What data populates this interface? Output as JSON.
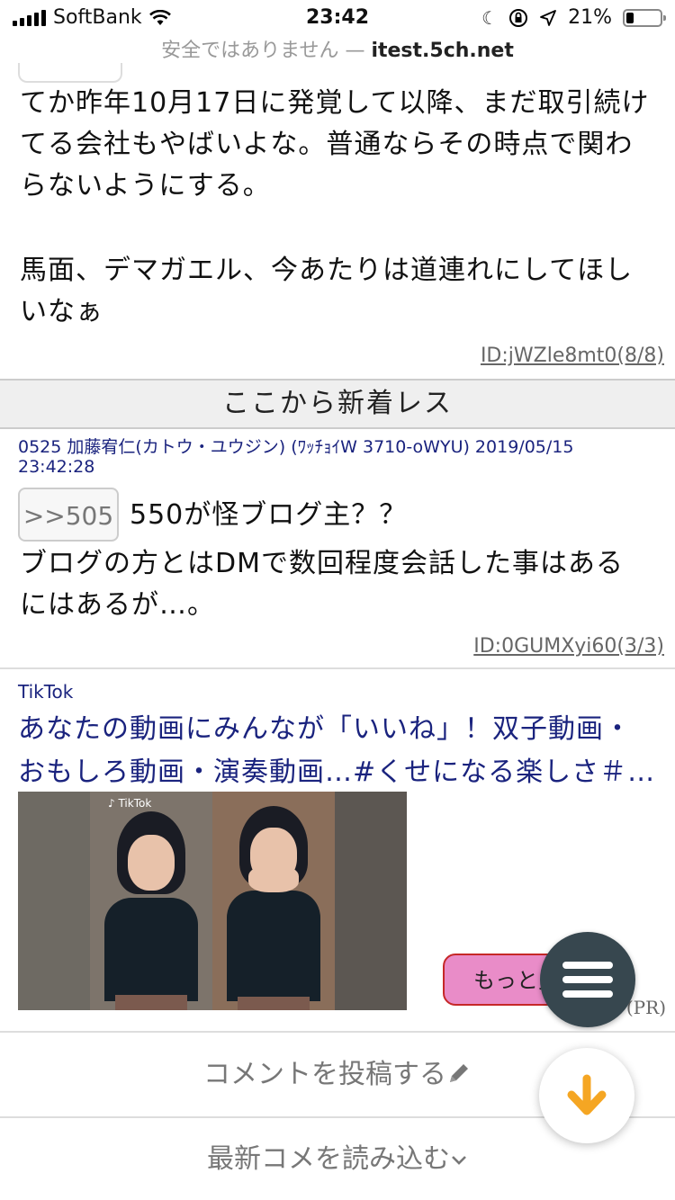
{
  "status_bar": {
    "carrier": "SoftBank",
    "time": "23:42",
    "battery": "21%"
  },
  "url_bar": {
    "security_warning": "安全ではありません —",
    "domain": "itest.5ch.net"
  },
  "previous_post": {
    "lines": [
      "てか昨年10月17日に発覚して以降、まだ取引続け",
      "てる会社もやばいよな。普通ならその時点で関わ",
      "らないようにする。",
      "馬面、デマガエル、今あたりは道連れにしてほし",
      "いなぁ"
    ],
    "id": "ID:jWZle8mt0(8/8)"
  },
  "new_posts_label": "ここから新着レス",
  "post": {
    "header_line1": "0525 加藤宥仁(カトウ・ユウジン) (ﾜｯﾁｮｲW 3710-oWYU) 2019/05/15",
    "header_line2": "23:42:28",
    "anchor": ">>505",
    "line1": "550が怪ブログ主？？",
    "line2": "ブログの方とはDMで数回程度会話した事はある",
    "line3": "にはあるが…。",
    "id": "ID:0GUMXyi60(3/3)"
  },
  "ad": {
    "source": "TikTok",
    "title_line1": "あなたの動画にみんなが「いいね」！双子動画・",
    "title_line2": "おもしろ動画・演奏動画…#くせになる楽しさ＃…",
    "image_logo": "♪ TikTok",
    "more_button": "もっと見る",
    "pr_label": "(PR)"
  },
  "actions": {
    "post_comment": "コメントを投稿する",
    "load_latest": "最新コメを読み込む"
  },
  "icons": {
    "menu": "hamburger-icon",
    "scroll_down": "arrow-down-icon",
    "edit": "pencil-icon"
  },
  "colors": {
    "link_blue": "#1a237e",
    "fab_dark": "#37474f",
    "fab_arrow": "#f5a623",
    "more_button_bg": "#e98cc8"
  }
}
